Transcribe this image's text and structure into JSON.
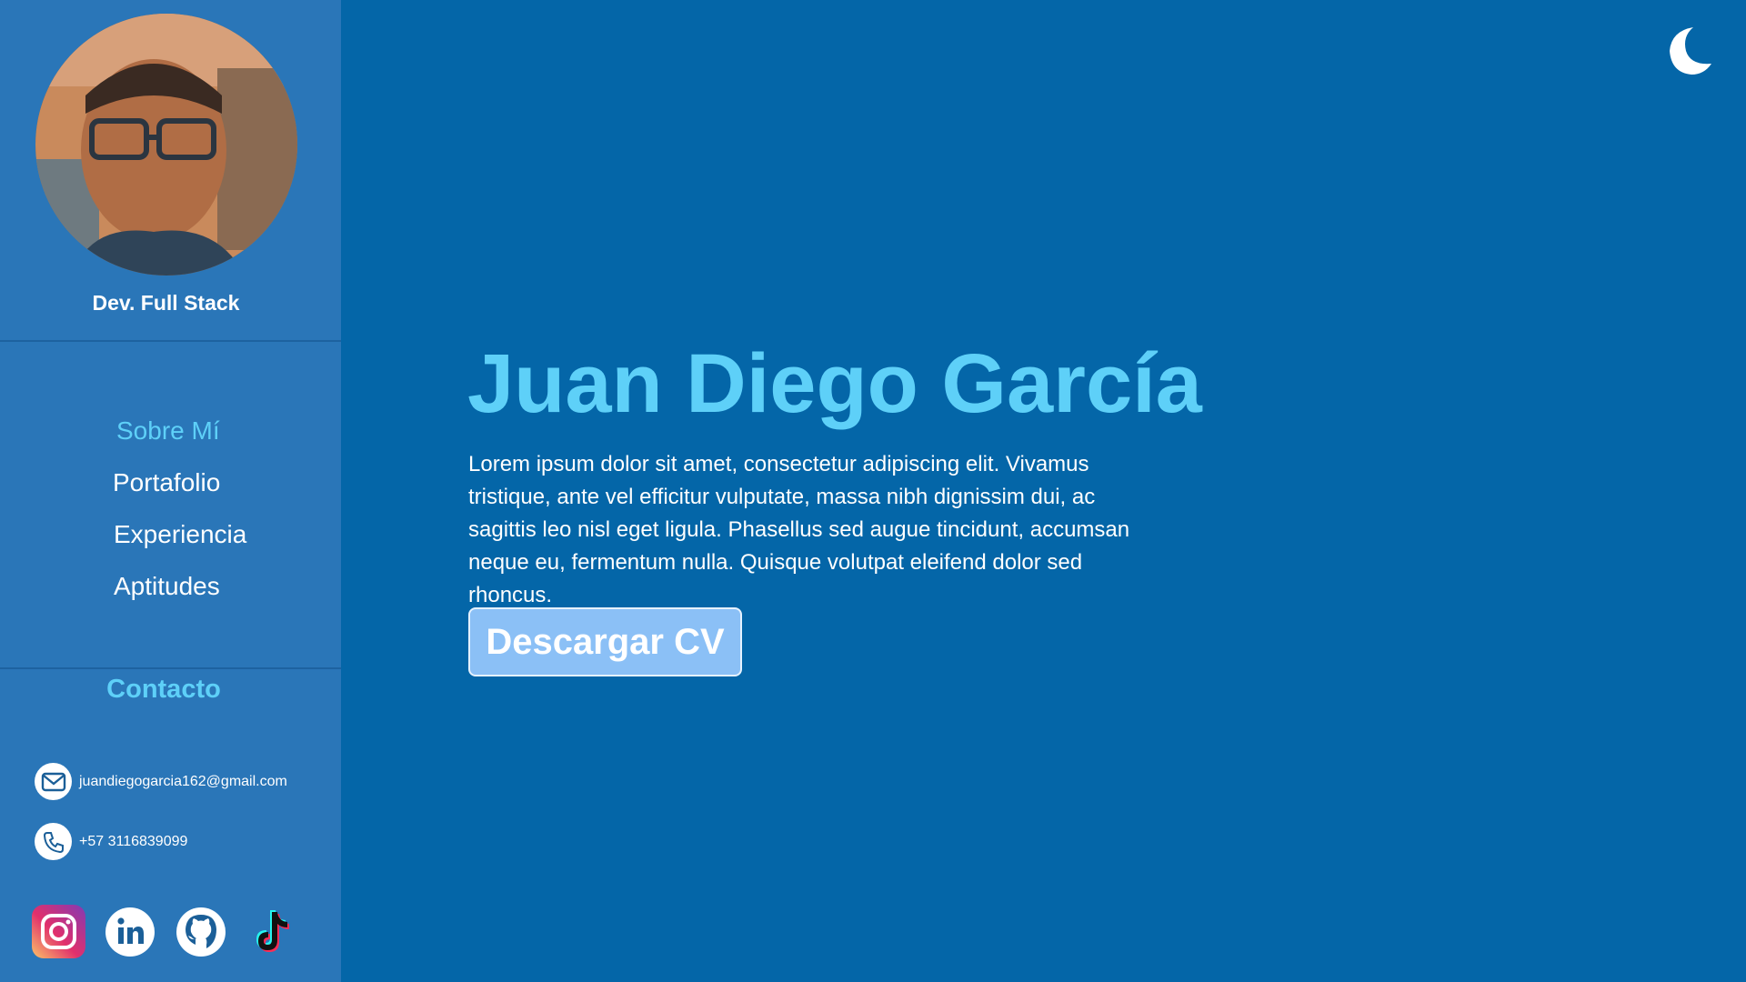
{
  "profile": {
    "role": "Dev. Full Stack",
    "avatar_icon": "profile-photo"
  },
  "nav": {
    "items": [
      {
        "label": "Sobre Mí",
        "active": true
      },
      {
        "label": "Portafolio",
        "active": false
      },
      {
        "label": "Experiencia",
        "active": false
      },
      {
        "label": "Aptitudes",
        "active": false
      }
    ]
  },
  "contact": {
    "title": "Contacto",
    "email": "juandiegogarcia162@gmail.com",
    "phone": "+57 3116839099",
    "email_icon": "mail-icon",
    "phone_icon": "phone-icon"
  },
  "socials": [
    "instagram-icon",
    "linkedin-icon",
    "github-icon",
    "tiktok-icon"
  ],
  "hero": {
    "name": "Juan Diego García",
    "description": "Lorem ipsum dolor sit amet, consectetur adipiscing elit. Vivamus tristique, ante vel efficitur vulputate, massa nibh dignissim dui, ac sagittis leo nisl eget ligula. Phasellus sed augue tincidunt, accumsan neque eu, fermentum nulla. Quisque volutpat eleifend dolor sed rhoncus.",
    "button_label": "Descargar CV"
  },
  "theme": {
    "toggle_icon": "moon-icon"
  },
  "colors": {
    "background": "#0466a8",
    "sidebar": "#2a76b8",
    "accent": "#5ed0f8",
    "button": "#8bc0f6"
  }
}
